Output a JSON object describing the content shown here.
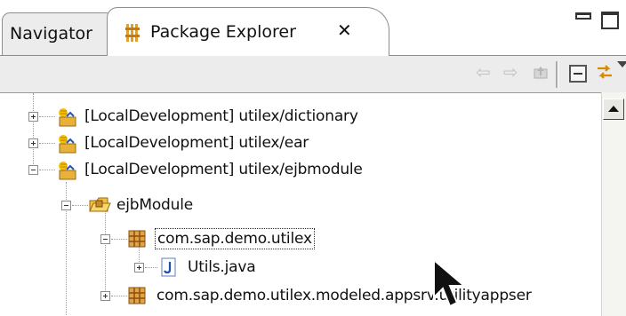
{
  "tabs": {
    "navigator_label": "Navigator",
    "package_explorer_label": "Package Explorer",
    "close_glyph": "✕"
  },
  "toolbar": {
    "back_glyph": "⇦",
    "forward_glyph": "⇨"
  },
  "tree": {
    "items": [
      {
        "label": "[LocalDevelopment] utilex/dictionary",
        "icon": "dc-project-icon",
        "expanded": false
      },
      {
        "label": "[LocalDevelopment] utilex/ear",
        "icon": "dc-project-icon",
        "expanded": false
      },
      {
        "label": "[LocalDevelopment] utilex/ejbmodule",
        "icon": "dc-project-icon",
        "expanded": true
      },
      {
        "label": "ejbModule",
        "icon": "source-folder-icon",
        "expanded": true
      },
      {
        "label": "com.sap.demo.utilex",
        "icon": "package-icon",
        "expanded": true,
        "selected": true
      },
      {
        "label": "Utils.java",
        "icon": "java-file-icon",
        "expanded": false
      },
      {
        "label": "com.sap.demo.utilex.modeled.appsrv.utilityappser",
        "icon": "package-icon",
        "expanded": false
      }
    ]
  },
  "colors": {
    "toolbar_bg": "#ececec",
    "package_icon": "#c98a2a",
    "java_icon": "#2a63b8"
  }
}
